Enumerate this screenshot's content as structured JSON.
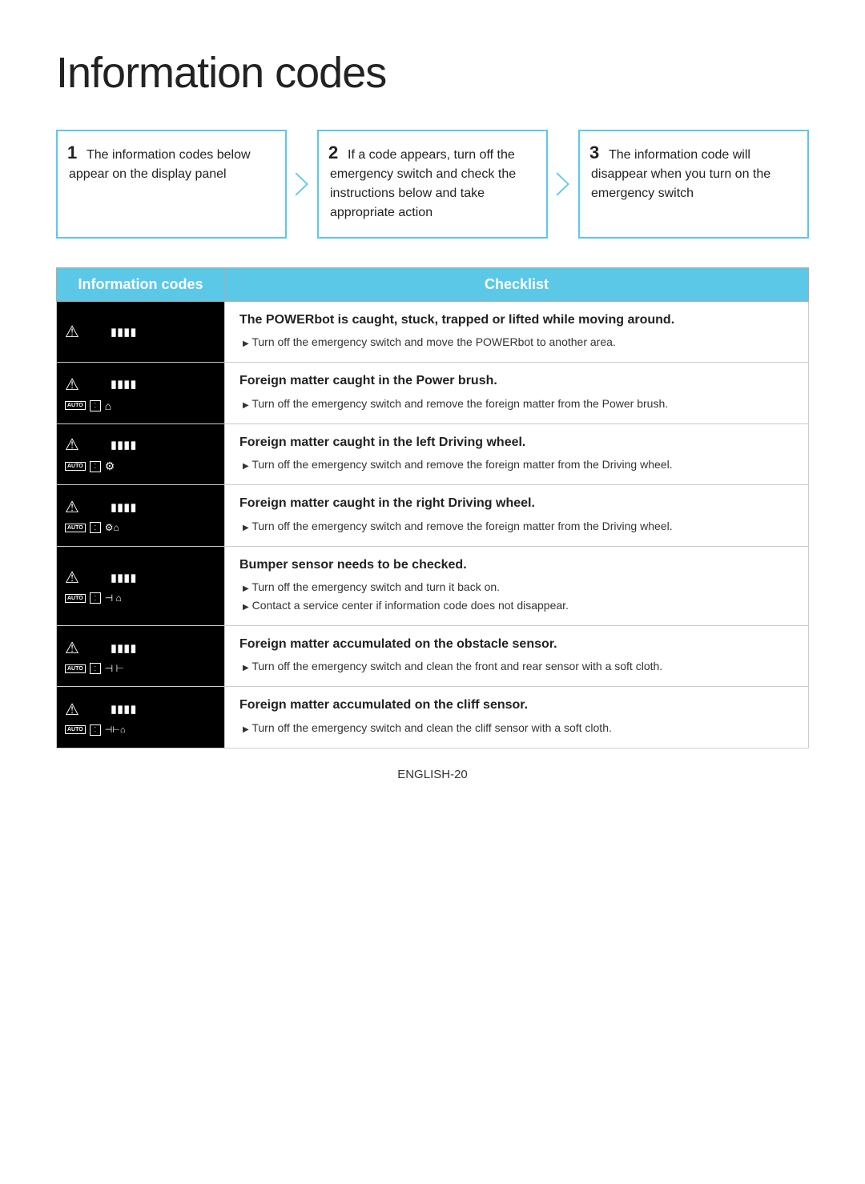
{
  "page": {
    "title": "Information codes",
    "footer": "ENGLISH-20"
  },
  "steps": [
    {
      "num": "1",
      "text": "The information codes below appear on the display panel"
    },
    {
      "num": "2",
      "text": "If a code appears, turn off the emergency switch and check the instructions below and take appropriate action"
    },
    {
      "num": "3",
      "text": "The information code will disappear when you turn on the emergency switch"
    }
  ],
  "table": {
    "col1_header": "Information codes",
    "col2_header": "Checklist",
    "rows": [
      {
        "icons": [
          "triangle",
          "bars"
        ],
        "bottom_icons": [],
        "heading": "The POWERbot is caught, stuck, trapped or lifted while moving around.",
        "bullets": [
          "Turn off the emergency switch and move the POWERbot to another area."
        ]
      },
      {
        "icons": [
          "triangle",
          "bars"
        ],
        "bottom_icons": [
          "auto-dot",
          "home"
        ],
        "heading": "Foreign matter caught in the Power brush.",
        "bullets": [
          "Turn off the emergency switch and remove the foreign matter from the Power brush."
        ]
      },
      {
        "icons": [
          "triangle",
          "bars"
        ],
        "bottom_icons": [
          "auto-dot",
          "wheel-left"
        ],
        "heading": "Foreign matter caught in the left Driving wheel.",
        "bullets": [
          "Turn off the emergency switch and remove the foreign matter from the Driving wheel."
        ]
      },
      {
        "icons": [
          "triangle",
          "bars"
        ],
        "bottom_icons": [
          "auto-dot",
          "wheel-right-home"
        ],
        "heading": "Foreign matter caught in the right Driving wheel.",
        "bullets": [
          "Turn off the emergency switch and remove the foreign matter from the Driving wheel."
        ]
      },
      {
        "icons": [
          "triangle",
          "bars"
        ],
        "bottom_icons": [
          "auto-dot",
          "bumper-home"
        ],
        "heading": "Bumper sensor needs to be checked.",
        "bullets": [
          "Turn off the emergency switch and turn it back on.",
          "Contact a service center if information code does not disappear."
        ]
      },
      {
        "icons": [
          "triangle",
          "bars"
        ],
        "bottom_icons": [
          "auto-dot",
          "obstacle"
        ],
        "heading": "Foreign matter accumulated on the obstacle sensor.",
        "bullets": [
          "Turn off the emergency switch and clean the front and rear sensor with a soft cloth."
        ]
      },
      {
        "icons": [
          "triangle",
          "bars"
        ],
        "bottom_icons": [
          "auto-dot",
          "cliff"
        ],
        "heading": "Foreign matter accumulated on the cliff sensor.",
        "bullets": [
          "Turn off the emergency switch and clean the cliff sensor with a soft cloth."
        ]
      }
    ]
  }
}
